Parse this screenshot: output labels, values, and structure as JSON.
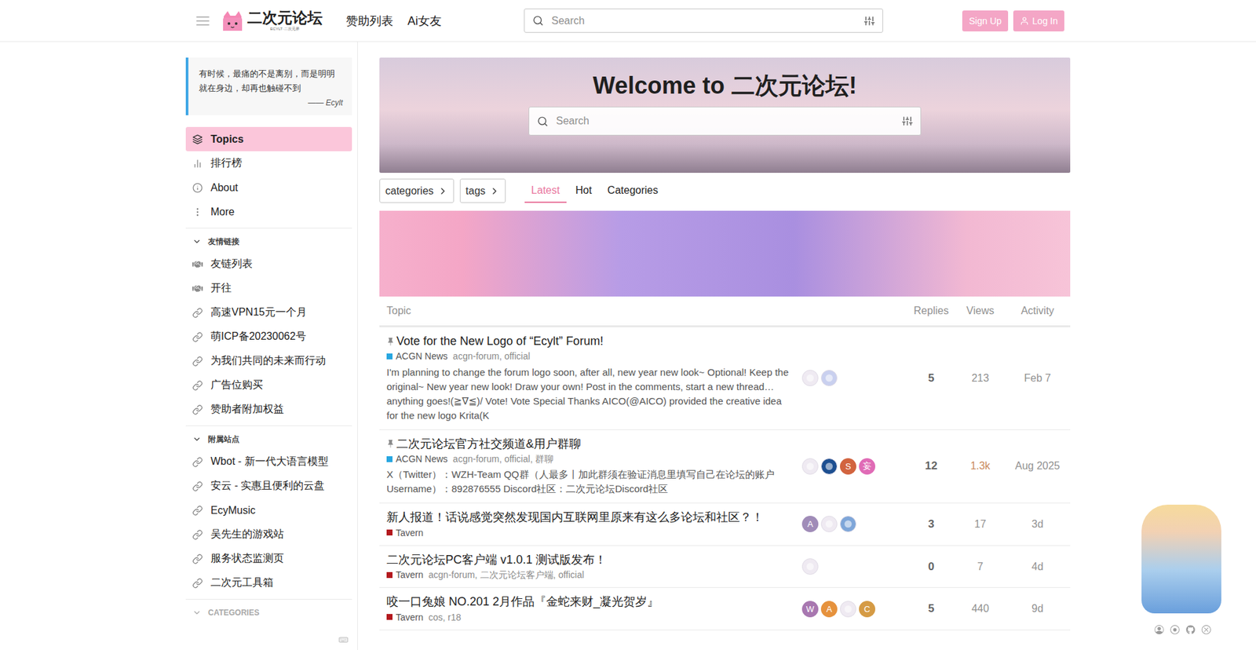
{
  "header": {
    "logo": {
      "title": "二次元论坛",
      "subtitle": "ECYLT·二次元界"
    },
    "nav": [
      "赞助列表",
      "Ai女友"
    ],
    "search": {
      "placeholder": "Search"
    },
    "buttons": [
      {
        "label": "Sign Up",
        "kind": "signup"
      },
      {
        "label": "Log In",
        "kind": "login"
      }
    ]
  },
  "sidebar": {
    "quote": {
      "text": "有时候，最痛的不是离别，而是明明就在身边，却再也触碰不到",
      "author": "—— Ecylt"
    },
    "items": [
      {
        "label": "Topics",
        "kind": "topics",
        "selected": true
      },
      {
        "label": "排行榜",
        "kind": "ranking",
        "selected": false
      },
      {
        "label": "About",
        "kind": "about",
        "selected": false
      },
      {
        "label": "More",
        "kind": "more",
        "selected": false
      }
    ],
    "sections": [
      {
        "title": "友情链接",
        "expanded": true,
        "items": [
          {
            "label": "友链列表",
            "kind": "friend"
          },
          {
            "label": "开往",
            "kind": "friend"
          },
          {
            "label": "高速VPN15元一个月",
            "kind": "link"
          },
          {
            "label": "萌ICP备20230062号",
            "kind": "link"
          },
          {
            "label": "为我们共同的未来而行动",
            "kind": "link"
          },
          {
            "label": "广告位购买",
            "kind": "link"
          },
          {
            "label": "赞助者附加权益",
            "kind": "link"
          }
        ]
      },
      {
        "title": "附属站点",
        "expanded": true,
        "items": [
          {
            "label": "Wbot - 新一代大语言模型",
            "kind": "link"
          },
          {
            "label": "安云 - 实惠且便利的云盘",
            "kind": "link"
          },
          {
            "label": "EcyMusic",
            "kind": "link"
          },
          {
            "label": "吴先生的游戏站",
            "kind": "link"
          },
          {
            "label": "服务状态监测页",
            "kind": "link"
          },
          {
            "label": "二次元工具箱",
            "kind": "link"
          }
        ]
      },
      {
        "title": "CATEGORIES",
        "expanded": true,
        "items": []
      }
    ]
  },
  "banner": {
    "title": "Welcome to 二次元论坛!",
    "search": {
      "placeholder": "Search"
    }
  },
  "filters": {
    "dropdowns": [
      "categories",
      "tags"
    ],
    "tabs": [
      {
        "label": "Latest",
        "selected": true
      },
      {
        "label": "Hot",
        "selected": false
      },
      {
        "label": "Categories",
        "selected": false
      }
    ]
  },
  "table": {
    "columns": [
      "Topic",
      "Replies",
      "Views",
      "Activity"
    ],
    "rows": [
      {
        "title": "Vote for the New Logo of “Ecylt” Forum!",
        "pinned": true,
        "category": {
          "name": "ACGN News",
          "color": "#27a6e0"
        },
        "tags": "acgn-forum, official",
        "excerpt": "I'm planning to change the forum logo soon, after all, new year new look~ Optional! Keep the original~ New year new look! Draw your own! Post in the comments, start a new thread… anything goes!(≧∇≦)/ Vote! Vote Special Thanks AICO(@AICO) provided the creative idea for the new logo Krita(K",
        "avatars": [
          {
            "kind": "image",
            "color": "#efeaf2"
          },
          {
            "kind": "image",
            "color": "#c9d0ef"
          }
        ],
        "replies": "5",
        "views": "213",
        "hot": false,
        "activity": "Feb 7"
      },
      {
        "title": "二次元论坛官方社交频道&用户群聊",
        "pinned": true,
        "category": {
          "name": "ACGN News",
          "color": "#27a6e0"
        },
        "tags": "acgn-forum, official, 群聊",
        "excerpt": "X（Twitter）：WZH-Team QQ群（人最多丨加此群须在验证消息里填写自己在论坛的账户Username）：892876555 Discord社区：二次元论坛Discord社区",
        "avatars": [
          {
            "kind": "image",
            "color": "#efeaf2"
          },
          {
            "kind": "image",
            "color": "#1d4f91"
          },
          {
            "kind": "letter",
            "letter": "S",
            "color": "#d2643f"
          },
          {
            "kind": "letter",
            "letter": "妄",
            "color": "#e06bb6"
          }
        ],
        "replies": "12",
        "views": "1.3k",
        "hot": true,
        "activity": "Aug 2025"
      },
      {
        "title": "新人报道！话说感觉突然发现国内互联网里原来有这么多论坛和社区？！",
        "pinned": false,
        "category": {
          "name": "Tavern",
          "color": "#b3181d"
        },
        "tags": "",
        "excerpt": "",
        "avatars": [
          {
            "kind": "letter",
            "letter": "A",
            "color": "#a08cb8"
          },
          {
            "kind": "image",
            "color": "#efeaf2"
          },
          {
            "kind": "image",
            "color": "#7ea6d9"
          }
        ],
        "replies": "3",
        "views": "17",
        "hot": false,
        "activity": "3d"
      },
      {
        "title": "二次元论坛PC客户端 v1.0.1 测试版发布！",
        "pinned": false,
        "category": {
          "name": "Tavern",
          "color": "#b3181d"
        },
        "tags": "acgn-forum, 二次元论坛客户端, official",
        "excerpt": "",
        "avatars": [
          {
            "kind": "image",
            "color": "#efeaf2"
          }
        ],
        "replies": "0",
        "views": "7",
        "hot": false,
        "activity": "4d"
      },
      {
        "title": "咬一口兔娘 NO.201 2月作品『金蛇来财_凝光贺岁』",
        "pinned": false,
        "category": {
          "name": "Tavern",
          "color": "#b3181d"
        },
        "tags": "cos, r18",
        "excerpt": "",
        "avatars": [
          {
            "kind": "letter",
            "letter": "W",
            "color": "#a877b0"
          },
          {
            "kind": "letter",
            "letter": "A",
            "color": "#e6923d"
          },
          {
            "kind": "image",
            "color": "#efeaf2"
          },
          {
            "kind": "letter",
            "letter": "C",
            "color": "#d59b45"
          }
        ],
        "replies": "5",
        "views": "440",
        "hot": false,
        "activity": "9d"
      }
    ]
  }
}
